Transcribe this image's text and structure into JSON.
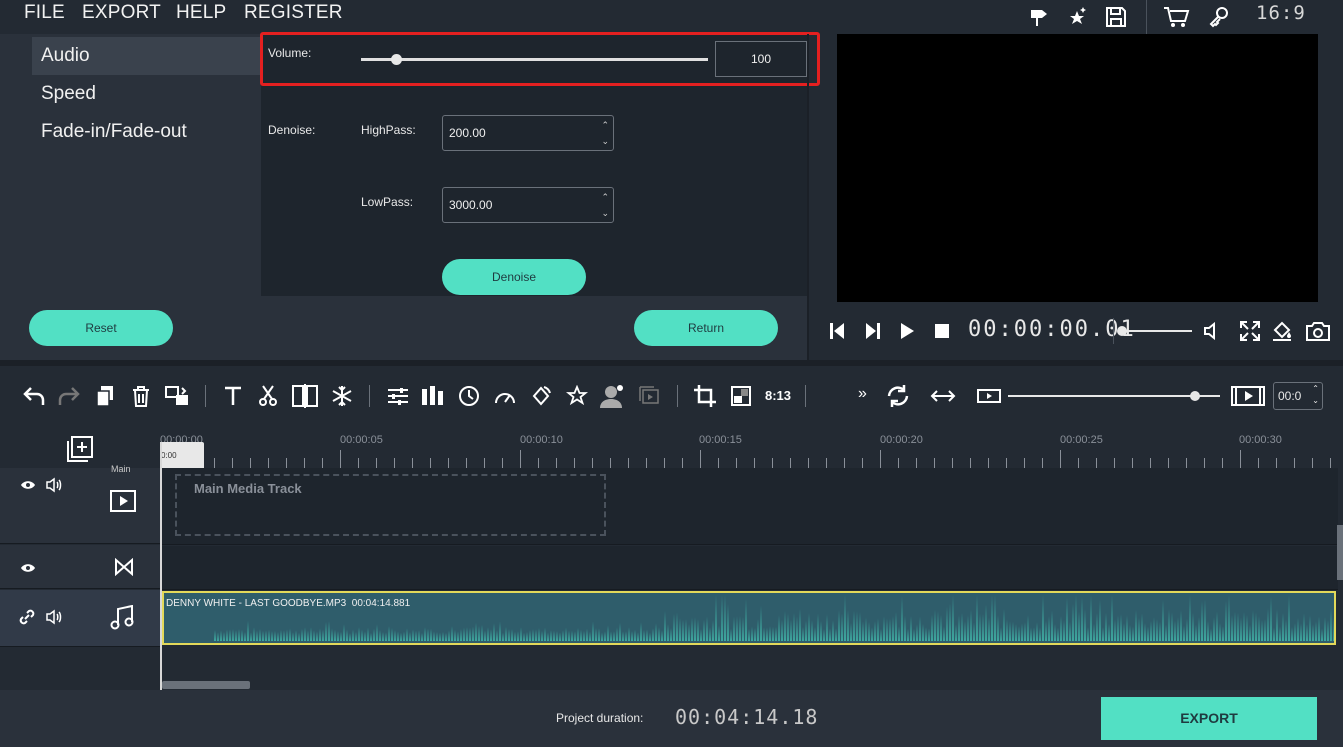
{
  "menu": {
    "file": "FILE",
    "export": "EXPORT",
    "help": "HELP",
    "register": "REGISTER"
  },
  "top_icons": [
    "pin-icon",
    "sparkle-star-icon",
    "save-icon",
    "cart-icon",
    "key-icon"
  ],
  "aspect_ratio": "16:9",
  "sidebar": {
    "items": [
      {
        "label": "Audio"
      },
      {
        "label": "Speed"
      },
      {
        "label": "Fade-in/Fade-out"
      }
    ]
  },
  "audio_settings": {
    "volume_label": "Volume:",
    "volume_value": "100",
    "volume_level": 0.1,
    "denoise_label": "Denoise:",
    "highpass_label": "HighPass:",
    "highpass_value": "200.00",
    "lowpass_label": "LowPass:",
    "lowpass_value": "3000.00",
    "denoise_button": "Denoise"
  },
  "actions": {
    "reset": "Reset",
    "return": "Return"
  },
  "player": {
    "timecode": "00:00:00.01",
    "volume_level": 0.0
  },
  "toolbar": {
    "ratio_label": "8:13",
    "more": "»",
    "zoom_field": "00:0",
    "zoom_level": 0.88
  },
  "ruler": {
    "labels": [
      "00:00:00",
      "00:00:05",
      "00:00:10",
      "00:00:15",
      "00:00:20",
      "00:00:25",
      "00:00:30"
    ],
    "playhead": "0:00"
  },
  "tracks": {
    "main_label": "Main Media Track",
    "main_head_text": "Main",
    "audio_clip": "DENNY WHITE - LAST GOODBYE.MP3  00:04:14.881"
  },
  "footer": {
    "duration_label": "Project duration:",
    "duration_value": "00:04:14.18",
    "export": "EXPORT"
  }
}
